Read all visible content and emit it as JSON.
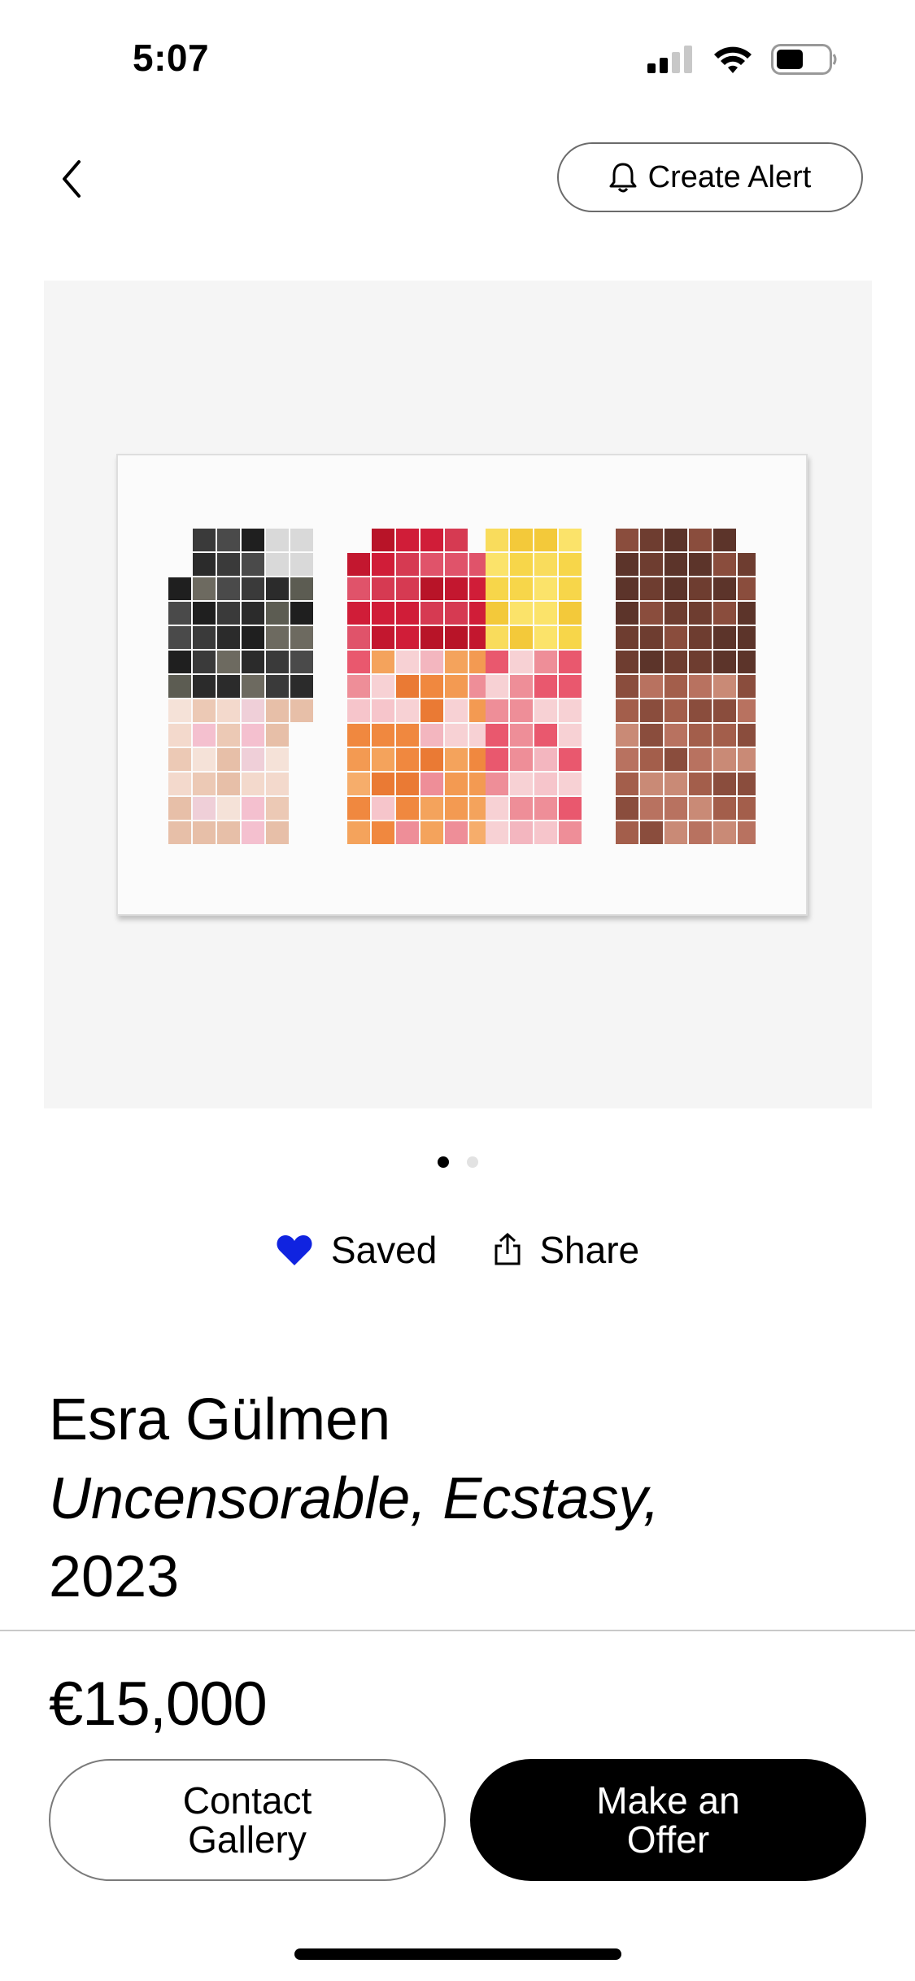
{
  "status_bar": {
    "time": "5:07"
  },
  "header": {
    "alert_label": "Create Alert"
  },
  "gallery": {
    "page_count": 2,
    "current_page": 1
  },
  "actions": {
    "saved_label": "Saved",
    "share_label": "Share"
  },
  "artwork": {
    "artist": "Esra Gülmen",
    "title": "Uncensorable, Ecstasy,",
    "year": "2023",
    "price": "€15,000"
  },
  "buttons": {
    "contact_line1": "Contact",
    "contact_line2": "Gallery",
    "offer_line1": "Make an",
    "offer_line2": "Offer"
  },
  "colors": {
    "accent_heart": "#1023e0",
    "primary_button": "#000000",
    "background": "#ffffff"
  },
  "icons": [
    "back-chevron-icon",
    "bell-icon",
    "heart-icon",
    "share-icon",
    "signal-icon",
    "wifi-icon",
    "battery-icon"
  ]
}
